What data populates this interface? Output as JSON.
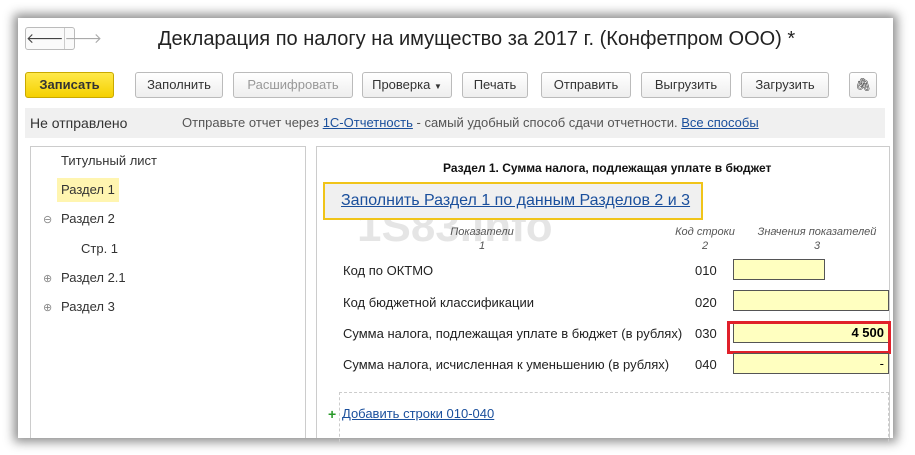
{
  "window": {
    "title": "Декларация по налогу на имущество за 2017 г. (Конфетпром ООО) *",
    "back": "🡐",
    "forward": "🡒"
  },
  "toolbar": {
    "save": "Записать",
    "fill": "Заполнить",
    "decode": "Расшифровать",
    "check": "Проверка",
    "print": "Печать",
    "send": "Отправить",
    "export": "Выгрузить",
    "import": "Загрузить",
    "attach": "🖇"
  },
  "status": {
    "state": "Не отправлено",
    "text_before": "Отправьте отчет через",
    "link1": "1С-Отчетность",
    "text_after": "- самый удобный способ сдачи отчетности.",
    "link2": "Все способы"
  },
  "tree": [
    {
      "label": "Титульный лист"
    },
    {
      "label": "Раздел 1"
    },
    {
      "label": "Раздел 2",
      "toggle": "⊖"
    },
    {
      "label": "Стр. 1"
    },
    {
      "label": "Раздел 2.1",
      "toggle": "⊕"
    },
    {
      "label": "Раздел 3",
      "toggle": "⊕"
    }
  ],
  "section": {
    "heading": "Раздел 1. Сумма налога, подлежащая уплате в бюджет",
    "fill_link": "Заполнить Раздел 1 по данным Разделов 2 и 3",
    "watermark": "1S83.info",
    "columns": [
      {
        "name": "Показатели",
        "num": "1"
      },
      {
        "name": "Код строки",
        "num": "2"
      },
      {
        "name": "Значения показателей",
        "num": "3"
      }
    ],
    "rows": [
      {
        "label": "Код по ОКТМО",
        "code": "010",
        "value": ""
      },
      {
        "label": "Код бюджетной классификации",
        "code": "020",
        "value": ""
      },
      {
        "label": "Сумма налога, подлежащая уплате в бюджет (в рублях)",
        "code": "030",
        "value": "4 500"
      },
      {
        "label": "Сумма налога, исчисленная к уменьшению (в рублях)",
        "code": "040",
        "value": "-"
      }
    ],
    "add_link": "Добавить строки 010-040",
    "add_icon": "+"
  }
}
